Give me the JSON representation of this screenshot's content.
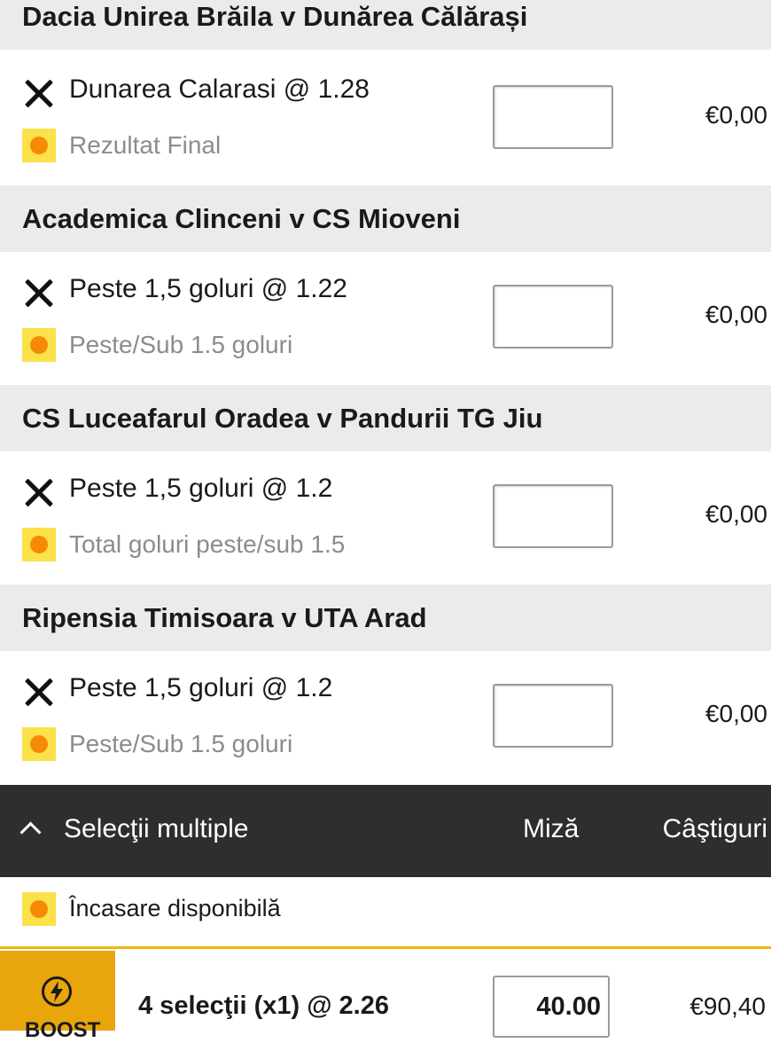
{
  "colors": {
    "accent": "#f2b705",
    "badge_bg": "#fbe14a",
    "badge_dot": "#f58a07",
    "header_bg": "#ebebeb",
    "bar_bg": "#2e2e2e",
    "boost_bg": "#e8a50c"
  },
  "matches": [
    {
      "title": "Dacia Unirea Brăila v Dunărea Călărași",
      "pick": "Dunarea Calarasi @ 1.28",
      "market": "Rezultat Final",
      "stake": "",
      "win": "€0,00"
    },
    {
      "title": "Academica Clinceni v CS Mioveni",
      "pick": "Peste 1,5 goluri @ 1.22",
      "market": "Peste/Sub 1.5 goluri",
      "stake": "",
      "win": "€0,00"
    },
    {
      "title": "CS Luceafarul Oradea v Pandurii TG Jiu",
      "pick": "Peste 1,5 goluri @ 1.2",
      "market": "Total goluri peste/sub 1.5",
      "stake": "",
      "win": "€0,00"
    },
    {
      "title": "Ripensia Timisoara v UTA Arad",
      "pick": "Peste 1,5 goluri @ 1.2",
      "market": "Peste/Sub 1.5 goluri",
      "stake": "",
      "win": "€0,00"
    }
  ],
  "multiples": {
    "toggle_icon": "chevron-up-icon",
    "label": "Selecţii multiple",
    "stake_header": "Miză",
    "winnings_header": "Câştiguri"
  },
  "cashout": {
    "label": "Încasare disponibilă"
  },
  "accumulator": {
    "boost_icon": "lightning-icon",
    "boost_label": "BOOST",
    "text": "4 selecţii (x1) @ 2.26",
    "stake": "40.00",
    "win": "€90,40"
  }
}
